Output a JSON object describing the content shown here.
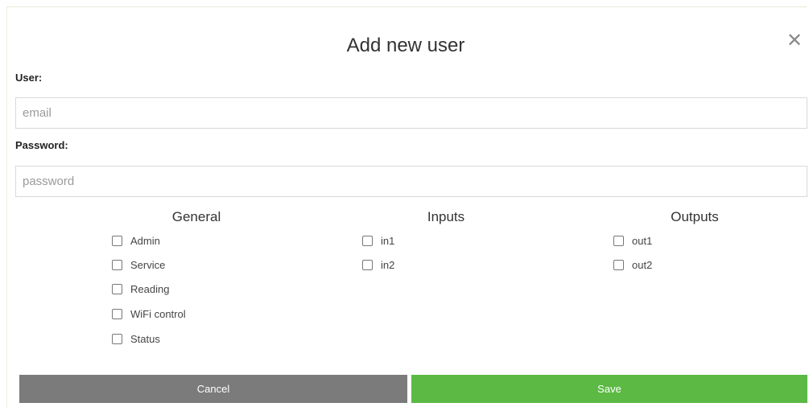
{
  "dialog": {
    "title": "Add new user",
    "close_glyph": "✕"
  },
  "user_field": {
    "label": "User:",
    "placeholder": "email",
    "value": ""
  },
  "password_field": {
    "label": "Password:",
    "placeholder": "password",
    "value": ""
  },
  "permissions": {
    "general": {
      "title": "General",
      "items": [
        {
          "label": "Admin",
          "checked": false
        },
        {
          "label": "Service",
          "checked": false
        },
        {
          "label": "Reading",
          "checked": false
        },
        {
          "label": "WiFi control",
          "checked": false
        },
        {
          "label": "Status",
          "checked": false
        }
      ]
    },
    "inputs": {
      "title": "Inputs",
      "items": [
        {
          "label": "in1",
          "checked": false
        },
        {
          "label": "in2",
          "checked": false
        }
      ]
    },
    "outputs": {
      "title": "Outputs",
      "items": [
        {
          "label": "out1",
          "checked": false
        },
        {
          "label": "out2",
          "checked": false
        }
      ]
    }
  },
  "actions": {
    "cancel_label": "Cancel",
    "save_label": "Save"
  },
  "colors": {
    "cancel_bg": "#7b7b7b",
    "save_bg": "#5bb944",
    "close_icon": "#8a8a8a"
  }
}
